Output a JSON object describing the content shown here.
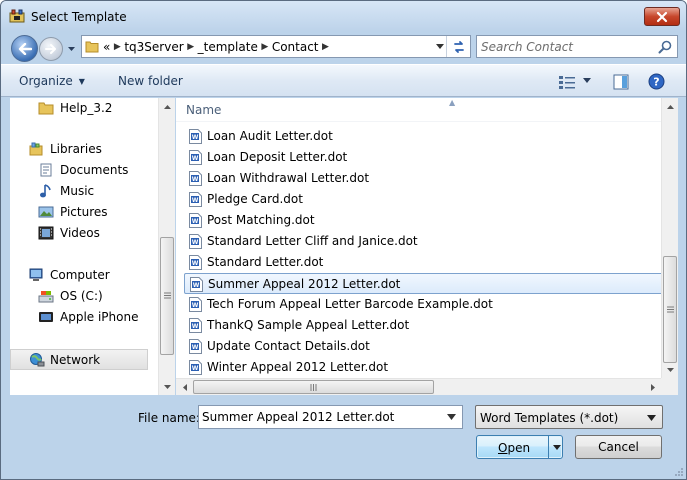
{
  "window": {
    "title": "Select Template",
    "close_icon": "close-icon"
  },
  "address": {
    "overflow": "«",
    "crumbs": [
      "tq3Server",
      "_template",
      "Contact"
    ],
    "search_placeholder": "Search Contact"
  },
  "toolbar": {
    "organize_label": "Organize",
    "new_folder_label": "New folder"
  },
  "nav": {
    "items": [
      {
        "label": "Help_3.2",
        "icon": "folder-icon"
      },
      {
        "label": "Libraries",
        "icon": "libraries-icon"
      },
      {
        "label": "Documents",
        "icon": "documents-icon"
      },
      {
        "label": "Music",
        "icon": "music-icon"
      },
      {
        "label": "Pictures",
        "icon": "pictures-icon"
      },
      {
        "label": "Videos",
        "icon": "videos-icon"
      },
      {
        "label": "Computer",
        "icon": "computer-icon"
      },
      {
        "label": "OS (C:)",
        "icon": "drive-icon"
      },
      {
        "label": "Apple iPhone",
        "icon": "phone-icon"
      },
      {
        "label": "Network",
        "icon": "network-icon"
      }
    ]
  },
  "files": {
    "header": "Name",
    "items": [
      "Loan Audit Letter.dot",
      "Loan Deposit Letter.dot",
      "Loan Withdrawal Letter.dot",
      "Pledge Card.dot",
      "Post Matching.dot",
      "Standard Letter Cliff and Janice.dot",
      "Standard Letter.dot",
      "Summer Appeal 2012 Letter.dot",
      "Tech Forum Appeal Letter Barcode Example.dot",
      "ThankQ Sample Appeal Letter.dot",
      "Update Contact Details.dot",
      "Winter Appeal 2012 Letter.dot"
    ],
    "selected": "Summer Appeal 2012 Letter.dot"
  },
  "bottom": {
    "filename_label": "File name:",
    "filename_value": "Summer Appeal 2012 Letter.dot",
    "filetype_value": "Word Templates (*.dot)",
    "open_label": "Open",
    "cancel_label": "Cancel"
  }
}
